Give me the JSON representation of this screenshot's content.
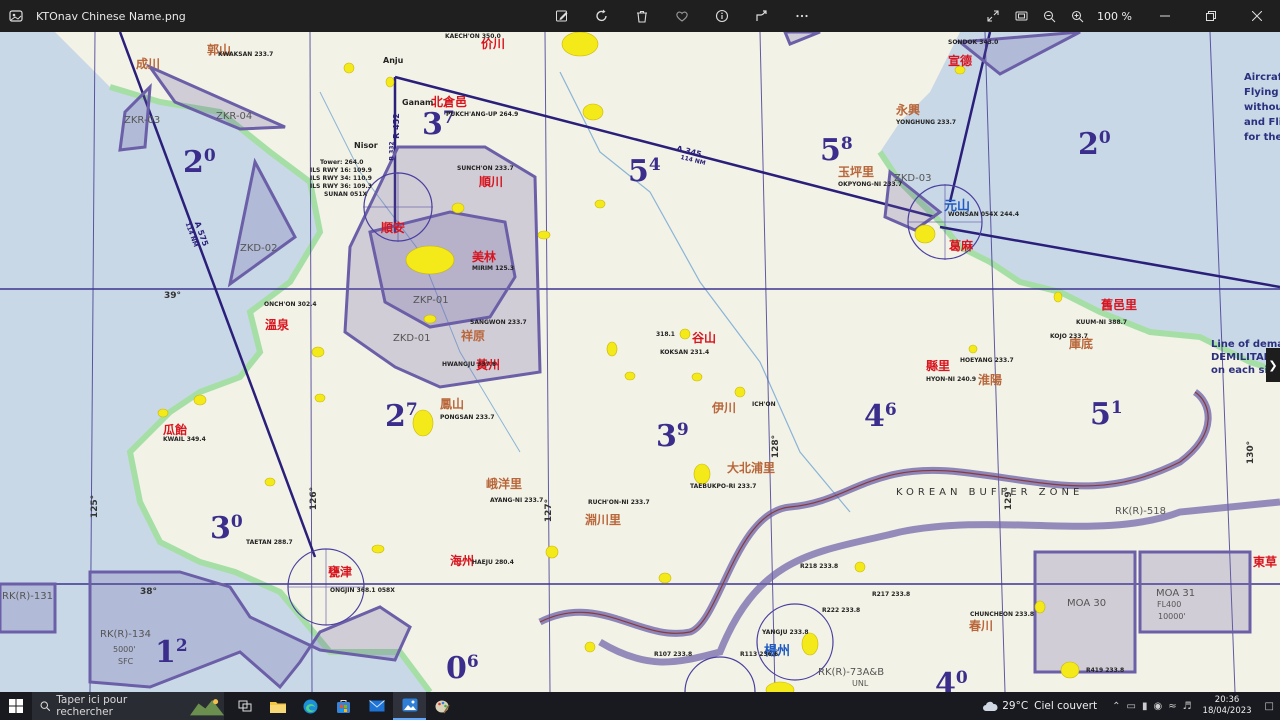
{
  "window": {
    "title": "KTOnav Chinese Name.png",
    "zoom": "100 %"
  },
  "map": {
    "grid_numbers": [
      {
        "main": "2",
        "sup": "0"
      },
      {
        "main": "3",
        "sup": "7"
      },
      {
        "main": "5",
        "sup": "4"
      },
      {
        "main": "5",
        "sup": "8"
      },
      {
        "main": "2",
        "sup": "0"
      },
      {
        "main": "2",
        "sup": "7"
      },
      {
        "main": "3",
        "sup": "9"
      },
      {
        "main": "4",
        "sup": "6"
      },
      {
        "main": "5",
        "sup": "1"
      },
      {
        "main": "3",
        "sup": "0"
      },
      {
        "main": "1",
        "sup": "2"
      },
      {
        "main": "0",
        "sup": "6"
      },
      {
        "main": "4",
        "sup": "0"
      }
    ],
    "red_labels": [
      "郭山",
      "价川",
      "北倉邑",
      "成川",
      "順川",
      "順安",
      "美林",
      "溫泉",
      "黃州",
      "谷山",
      "元山",
      "葛麻",
      "舊邑里",
      "瓜飴",
      "甕津",
      "海州",
      "楊州",
      "東草",
      "宣德",
      "縣里"
    ],
    "brown_labels": [
      "永興",
      "玉坪里",
      "祥原",
      "鳳山",
      "伊川",
      "大北浦里",
      "峨洋里",
      "淵川里",
      "春川",
      "淮陽",
      "庫底"
    ],
    "nav_labels": [
      "KWAKSAN 233.7",
      "KAECH'ON 350.0",
      "Anju",
      "Ganam",
      "PUKCH'ANG-UP 264.9",
      "Nisor",
      "Tower: 264.0",
      "ILS RWY 16: 109.9",
      "ILS RWY 34: 110.9",
      "ILS RWY 36: 109.3",
      "SUNAN 051X",
      "SUNCH'ON 233.7",
      "MIRIM 125.3",
      "SANGWON 233.7",
      "HWANGJU 337.6",
      "ONCH'ON 302.4",
      "KWAIL 349.4",
      "PONGSAN 233.7",
      "AYANG-NI 233.7",
      "TAETAN 288.7",
      "ONGJIN 368.1 058X",
      "HAEJU 280.4",
      "KOKSAN 231.4",
      "318.1",
      "ICH'ON",
      "TAEBUKPO-RI 233.7",
      "RUCH'ON-NI 233.7",
      "OKPYONG-NI 233.7",
      "WONSAN 054X 244.4",
      "SONDOK 343.0",
      "YONGHUNG 233.7",
      "HOEYANG 233.7",
      "HYON-NI 240.9",
      "KOJO 233.7",
      "KUUM-NI 388.7",
      "CHUNCHEON 233.8",
      "YANGJU 233.8",
      "R218 233.8",
      "R217 233.8",
      "R222 233.8",
      "R107 233.8",
      "R113 236.6",
      "R419 233.8"
    ],
    "zone_labels": [
      "ZKR-04",
      "ZKR-03",
      "ZKD-02",
      "ZKP-01",
      "ZKD-01",
      "ZKD-03",
      "RK(R)-131",
      "RK(R)-134",
      "RK(R)-518",
      "RK(R)-73A&B",
      "MOA 30",
      "MOA 31",
      "FL400",
      "10000'",
      "5000'",
      "SFC",
      "UNL"
    ],
    "airway_labels": [
      "A 345",
      "114 NM",
      "A 575",
      "114 NM",
      "R 452",
      "B 332"
    ],
    "lat_labels": [
      "39°",
      "38°"
    ],
    "lon_labels": [
      "125°",
      "126°",
      "127°",
      "128°",
      "129°",
      "130°"
    ],
    "buffer_zone": "KOREAN BUFFER ZONE",
    "legend_right": [
      "Aircraft",
      "Flying T",
      "without",
      "and Fli",
      "for the"
    ],
    "dmz_text": [
      "Line of demar",
      "DEMILITARIZE",
      "on each side"
    ],
    "colors": {
      "water": "#c8d8e8",
      "land": "#f2f1e5",
      "coast": "#a6e0a6",
      "zone": "#6b5fa8",
      "airway": "#2a1f7a",
      "city": "#f4ea1a",
      "red": "#d8141e",
      "brown": "#b8663a"
    }
  },
  "taskbar": {
    "search_placeholder": "Taper ici pour rechercher",
    "weather_temp": "29°C",
    "weather_desc": "Ciel couvert",
    "time": "20:36",
    "date": "18/04/2023"
  }
}
